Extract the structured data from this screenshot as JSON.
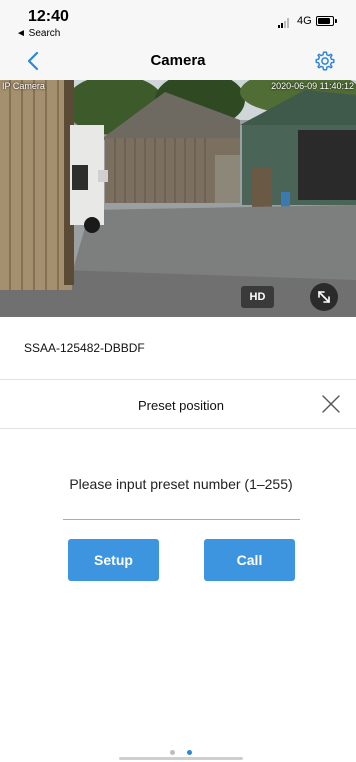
{
  "status_bar": {
    "time": "12:40",
    "back_app": "◄ Search",
    "network": "4G"
  },
  "nav": {
    "title": "Camera",
    "back_icon": "chevron-left-icon",
    "settings_icon": "gear-icon",
    "accent_color": "#2f86d8"
  },
  "camera": {
    "osd_label": "IP Camera",
    "osd_timestamp": "2020-06-09 11:40:12",
    "hd_label": "HD",
    "fullscreen_icon": "expand-icon"
  },
  "device": {
    "id": "SSAA-125482-DBBDF"
  },
  "preset_panel": {
    "title": "Preset position",
    "close_icon": "close-icon",
    "prompt": "Please input preset number (1–255)",
    "input_value": "",
    "setup_label": "Setup",
    "call_label": "Call",
    "button_color": "#3d95e0"
  },
  "pager": {
    "page_count": 2,
    "active_page": 2,
    "active_color": "#2f86d8",
    "inactive_color": "#bdbdbd"
  }
}
